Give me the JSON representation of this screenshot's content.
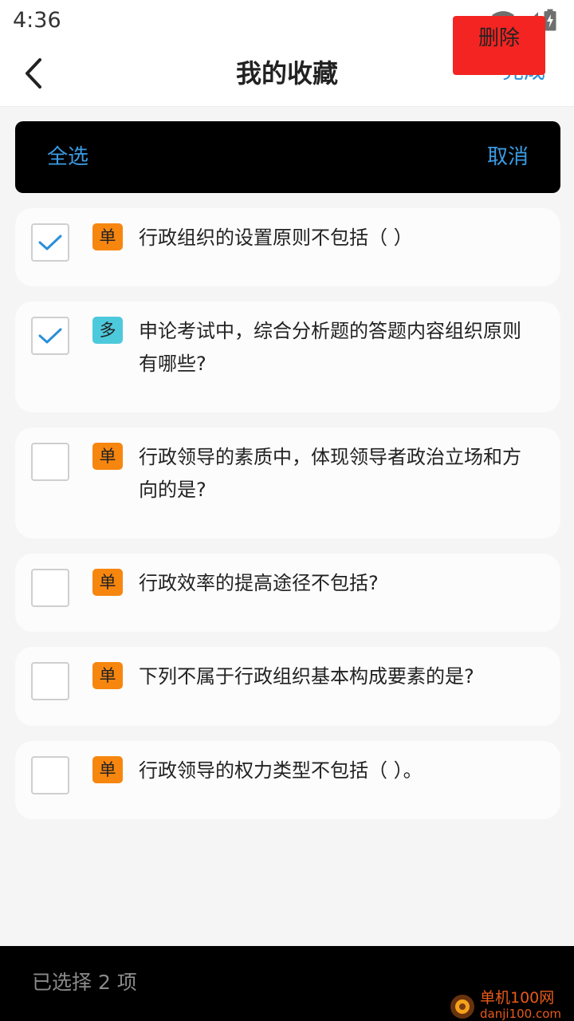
{
  "status_bar": {
    "time": "4:36",
    "icons": [
      "wifi-icon",
      "cellular-signal-icon",
      "battery-charging-icon"
    ]
  },
  "header": {
    "back_icon": "chevron-left-icon",
    "title": "我的收藏",
    "done_label": "完成"
  },
  "action_bar": {
    "select_all_label": "全选",
    "cancel_label": "取消"
  },
  "items": [
    {
      "type": "单",
      "kind": "single",
      "checked": true,
      "text": "行政组织的设置原则不包括（ ）"
    },
    {
      "type": "多",
      "kind": "multi",
      "checked": true,
      "text": "申论考试中，综合分析题的答题内容组织原则有哪些?"
    },
    {
      "type": "单",
      "kind": "single",
      "checked": false,
      "text": "行政领导的素质中，体现领导者政治立场和方向的是?"
    },
    {
      "type": "单",
      "kind": "single",
      "checked": false,
      "text": "行政效率的提高途径不包括?"
    },
    {
      "type": "单",
      "kind": "single",
      "checked": false,
      "text": "下列不属于行政组织基本构成要素的是?"
    },
    {
      "type": "单",
      "kind": "single",
      "checked": false,
      "text": "行政领导的权力类型不包括（ ）。"
    }
  ],
  "bottom_bar": {
    "selected_text": "已选择 2 项",
    "delete_label": "删除"
  },
  "watermark": {
    "site_name": "单机100网",
    "site_url": "danji100.com"
  },
  "colors": {
    "accent": "#2a8fd8",
    "single_badge": "#f7860f",
    "multi_badge": "#4dc9dc",
    "delete": "#f32421"
  }
}
